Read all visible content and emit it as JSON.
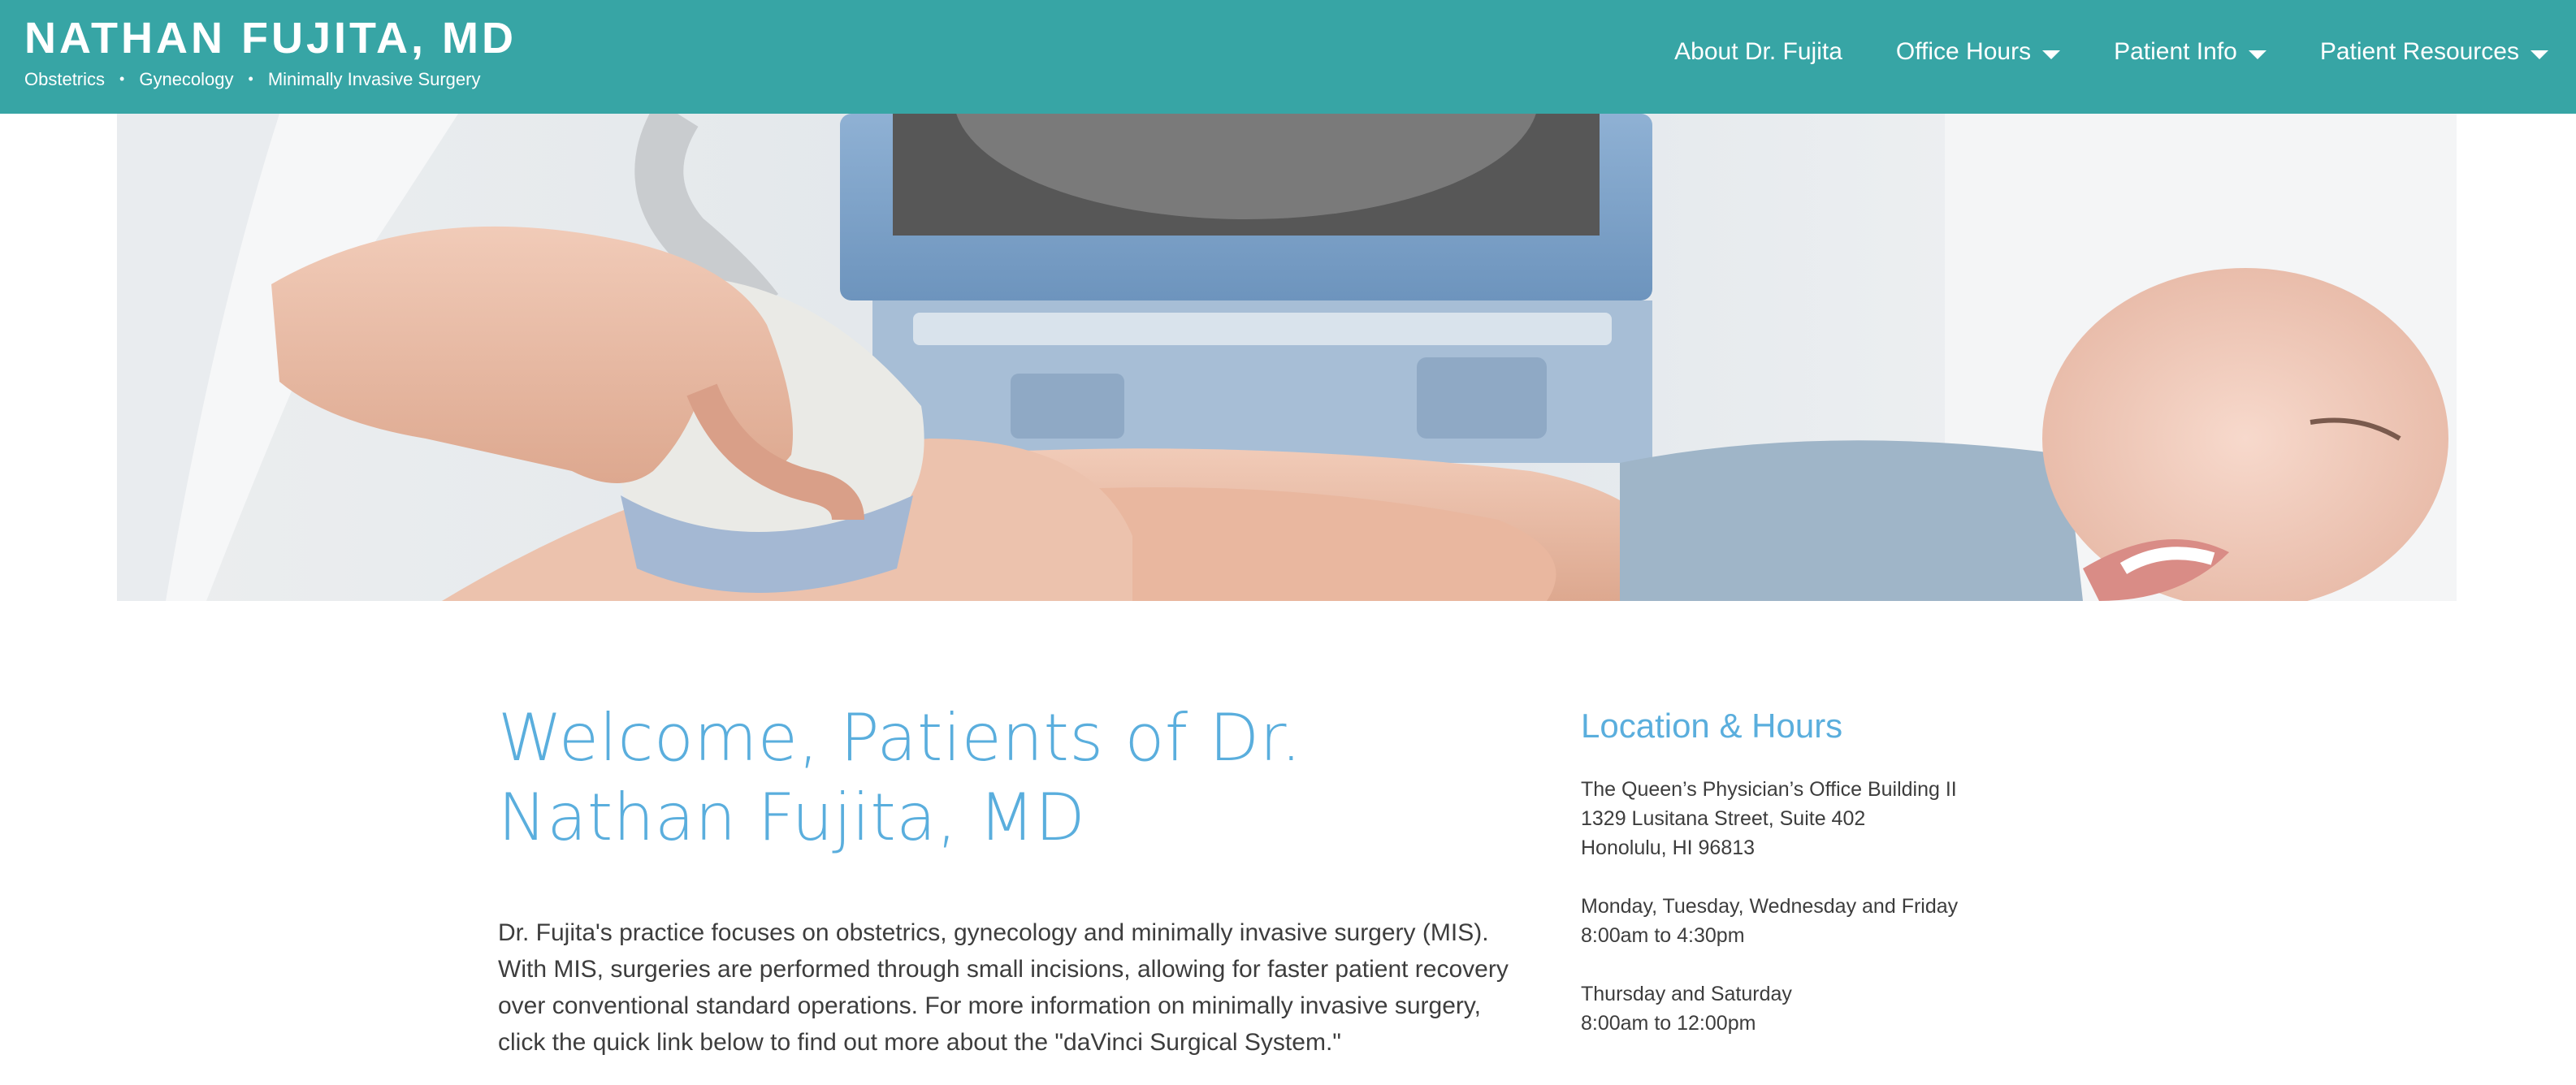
{
  "header": {
    "title": "NATHAN FUJITA, MD",
    "specialties": [
      "Obstetrics",
      "Gynecology",
      "Minimally Invasive Surgery"
    ],
    "separator": "•",
    "background_color": "#37a5a5"
  },
  "nav": {
    "items": [
      {
        "label": "About Dr. Fujita",
        "has_dropdown": false,
        "icon": "none"
      },
      {
        "label": "Office Hours",
        "has_dropdown": true,
        "icon": "caret-down-icon"
      },
      {
        "label": "Patient Info",
        "has_dropdown": true,
        "icon": "caret-down-icon"
      },
      {
        "label": "Patient Resources",
        "has_dropdown": true,
        "icon": "caret-down-icon"
      }
    ]
  },
  "hero": {
    "image": "ultrasound-exam-photo"
  },
  "main": {
    "heading": "Welcome, Patients of Dr. Nathan Fujita, MD",
    "intro": "Dr. Fujita's practice focuses on obstetrics, gynecology and minimally invasive surgery (MIS). With MIS, surgeries are performed through small incisions, allowing for faster patient recovery over conventional standard operations. For more information on minimally invasive surgery, click the quick link below to find out more about the \"daVinci Surgical System.\""
  },
  "sidebar": {
    "heading": "Location & Hours",
    "address": [
      "The Queen’s Physician’s Office Building II",
      "1329 Lusitana Street, Suite 402",
      "Honolulu, HI 96813"
    ],
    "hours": [
      {
        "days": "Monday, Tuesday, Wednesday and Friday",
        "time": "8:00am to 4:30pm"
      },
      {
        "days": "Thursday and Saturday",
        "time": "8:00am to 12:00pm"
      }
    ]
  },
  "colors": {
    "accent_blue": "#5aaedd",
    "body_text": "#3d3d3d"
  }
}
